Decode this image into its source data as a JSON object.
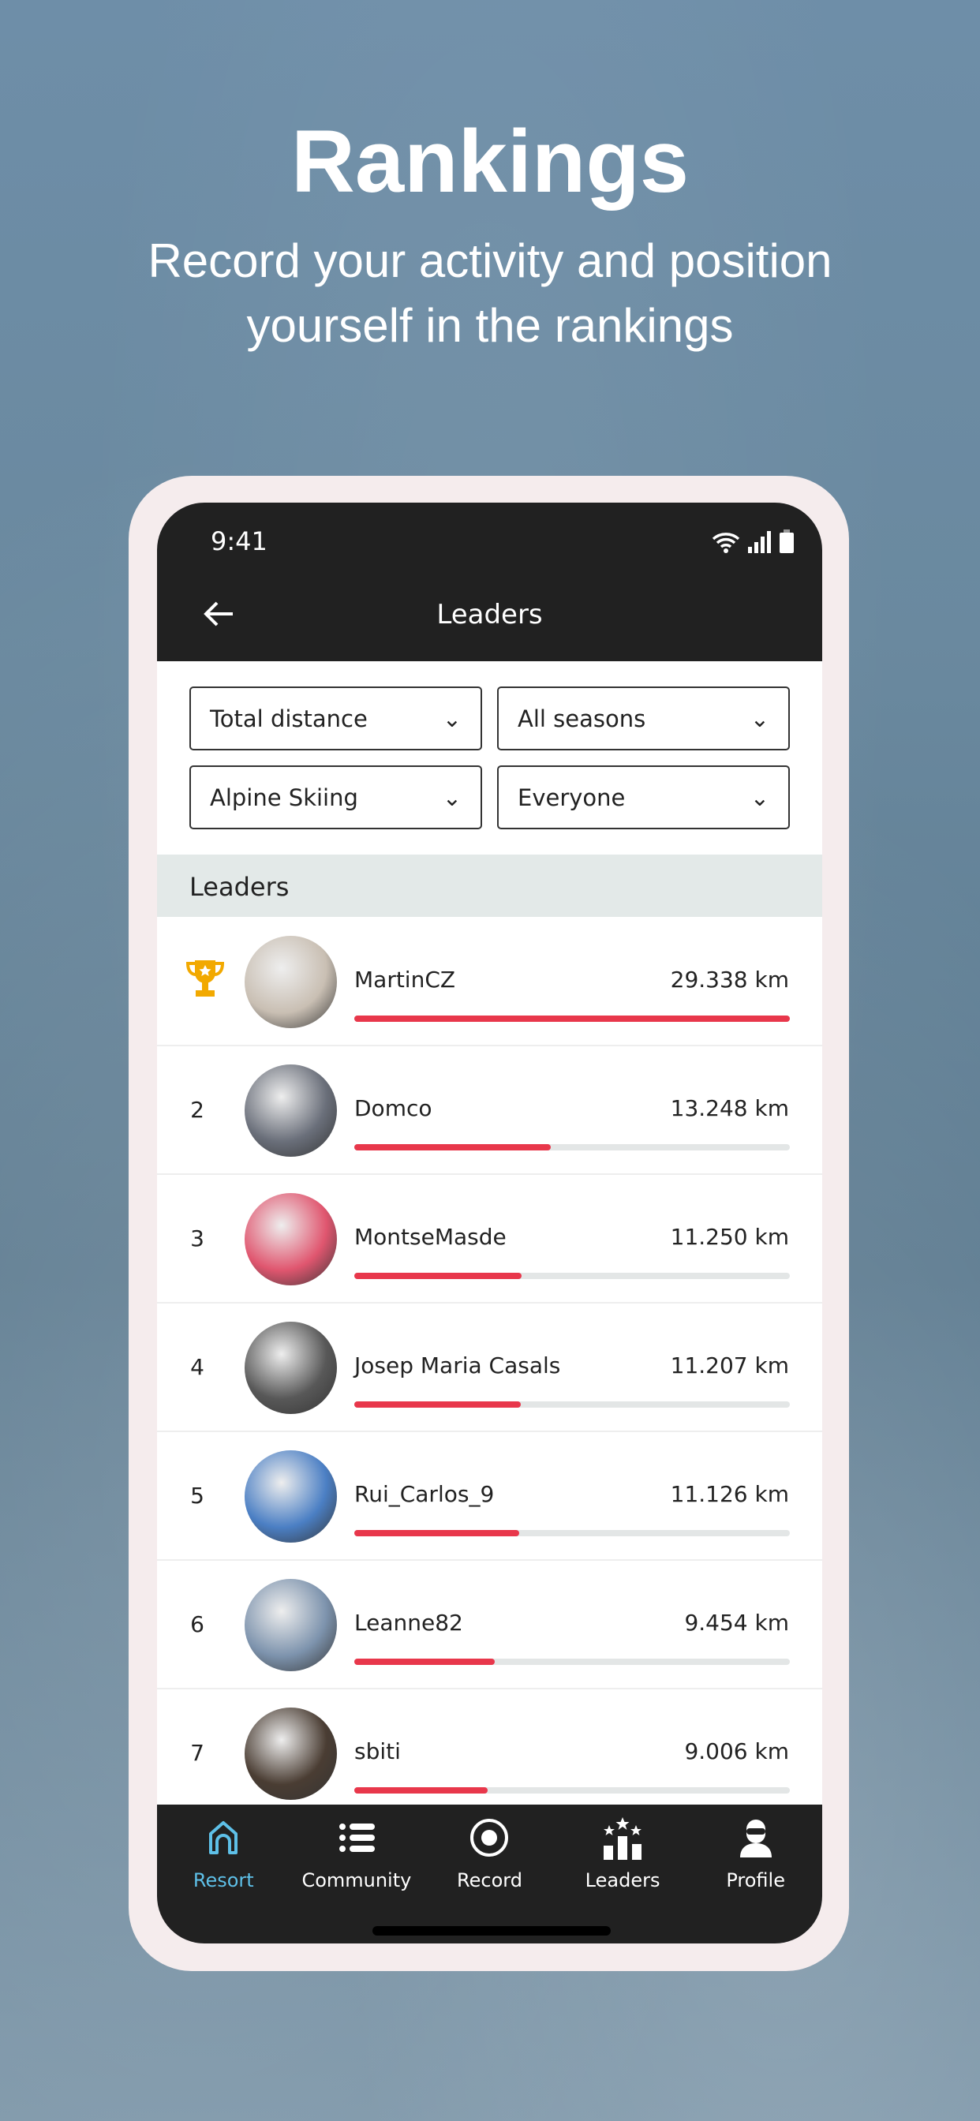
{
  "promo": {
    "title": "Rankings",
    "subtitle_line1": "Record your activity and position",
    "subtitle_line2": "yourself in the rankings"
  },
  "status_bar": {
    "time": "9:41"
  },
  "header": {
    "title": "Leaders",
    "back_icon": "arrow-left-icon"
  },
  "filters": [
    {
      "value": "Total distance"
    },
    {
      "value": "All seasons"
    },
    {
      "value": "Alpine Skiing"
    },
    {
      "value": "Everyone"
    }
  ],
  "section_title": "Leaders",
  "leaders": [
    {
      "rank": "1",
      "name": "MartinCZ",
      "distance": "29.338 km",
      "km": 29.338,
      "color": "#c9bfb3"
    },
    {
      "rank": "2",
      "name": "Domco",
      "distance": "13.248 km",
      "km": 13.248,
      "color": "#6a6f7a"
    },
    {
      "rank": "3",
      "name": "MontseMasde",
      "distance": "11.250 km",
      "km": 11.25,
      "color": "#e0566f"
    },
    {
      "rank": "4",
      "name": "Josep Maria Casals",
      "distance": "11.207 km",
      "km": 11.207,
      "color": "#585858"
    },
    {
      "rank": "5",
      "name": "Rui_Carlos_9",
      "distance": "11.126 km",
      "km": 11.126,
      "color": "#4b7fc4"
    },
    {
      "rank": "6",
      "name": "Leanne82",
      "distance": "9.454 km",
      "km": 9.454,
      "color": "#7d93ad"
    },
    {
      "rank": "7",
      "name": "sbiti",
      "distance": "9.006 km",
      "km": 9.006,
      "color": "#4a3d33"
    }
  ],
  "nav": [
    {
      "label": "Resort",
      "icon": "home-icon",
      "active": true
    },
    {
      "label": "Community",
      "icon": "list-icon"
    },
    {
      "label": "Record",
      "icon": "record-icon"
    },
    {
      "label": "Leaders",
      "icon": "leaderboard-icon"
    },
    {
      "label": "Profile",
      "icon": "skier-profile-icon"
    }
  ],
  "colors": {
    "accent": "#e8374b",
    "active_nav": "#5ec0e8",
    "trophy": "#f2a900"
  }
}
